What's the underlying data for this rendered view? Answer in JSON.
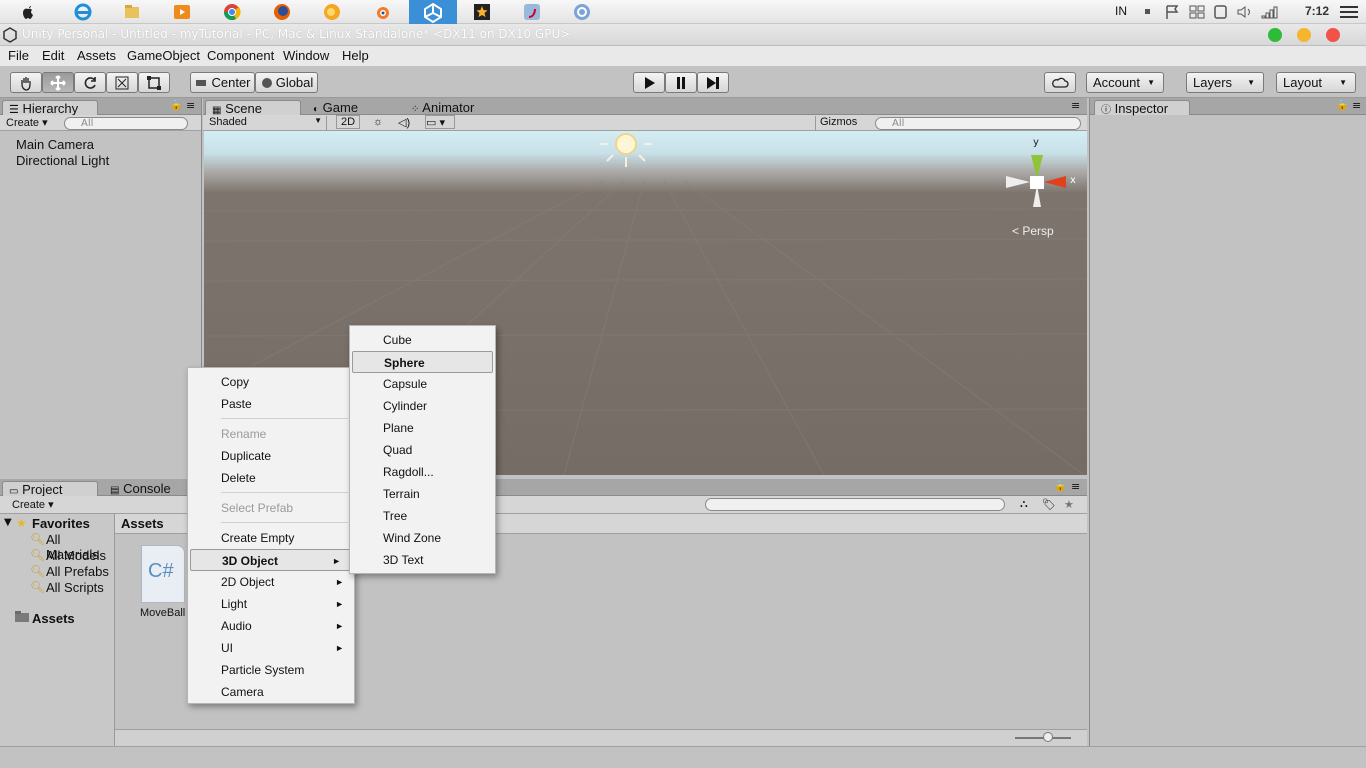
{
  "taskbar": {
    "lang": "IN",
    "time": "7:12",
    "apps": [
      "apple-icon",
      "ie-icon",
      "folder-icon",
      "media-icon",
      "chrome-icon",
      "firefox-icon",
      "firefox-alt-icon",
      "blender-icon",
      "unity-icon",
      "movie-icon",
      "flash-icon",
      "browser-icon"
    ]
  },
  "window": {
    "title": "Unity Personal - Untitled - myTutorial - PC, Mac & Linux Standalone* <DX11 on DX10 GPU>"
  },
  "menubar": [
    "File",
    "Edit",
    "Assets",
    "GameObject",
    "Component",
    "Window",
    "Help"
  ],
  "toolbar": {
    "center": "Center",
    "global": "Global",
    "account": "Account",
    "layers": "Layers",
    "layout": "Layout"
  },
  "hierarchy": {
    "tab": "Hierarchy",
    "create": "Create",
    "search_placeholder": "All",
    "items": [
      "Main Camera",
      "Directional Light"
    ]
  },
  "scene": {
    "tabs": [
      "Scene",
      "Game",
      "Animator"
    ],
    "shaded": "Shaded",
    "mode2d": "2D",
    "gizmos": "Gizmos",
    "search_placeholder": "All",
    "persp": "Persp",
    "axis_y": "y",
    "axis_x": "x"
  },
  "inspector": {
    "tab": "Inspector"
  },
  "project": {
    "tabs": [
      "Project",
      "Console"
    ],
    "create": "Create",
    "favorites": "Favorites",
    "favorite_items": [
      "All Materials",
      "All Models",
      "All Prefabs",
      "All Scripts"
    ],
    "assets_folder": "Assets",
    "assets_header": "Assets",
    "asset_name": "MoveBall",
    "asset_icon_text": "C#"
  },
  "context_menu": {
    "items": [
      "Copy",
      "Paste",
      "Rename",
      "Duplicate",
      "Delete",
      "Select Prefab",
      "Create Empty",
      "3D Object",
      "2D Object",
      "Light",
      "Audio",
      "UI",
      "Particle System",
      "Camera"
    ]
  },
  "submenu": {
    "items": [
      "Cube",
      "Sphere",
      "Capsule",
      "Cylinder",
      "Plane",
      "Quad",
      "Ragdoll...",
      "Terrain",
      "Tree",
      "Wind Zone",
      "3D Text"
    ]
  }
}
